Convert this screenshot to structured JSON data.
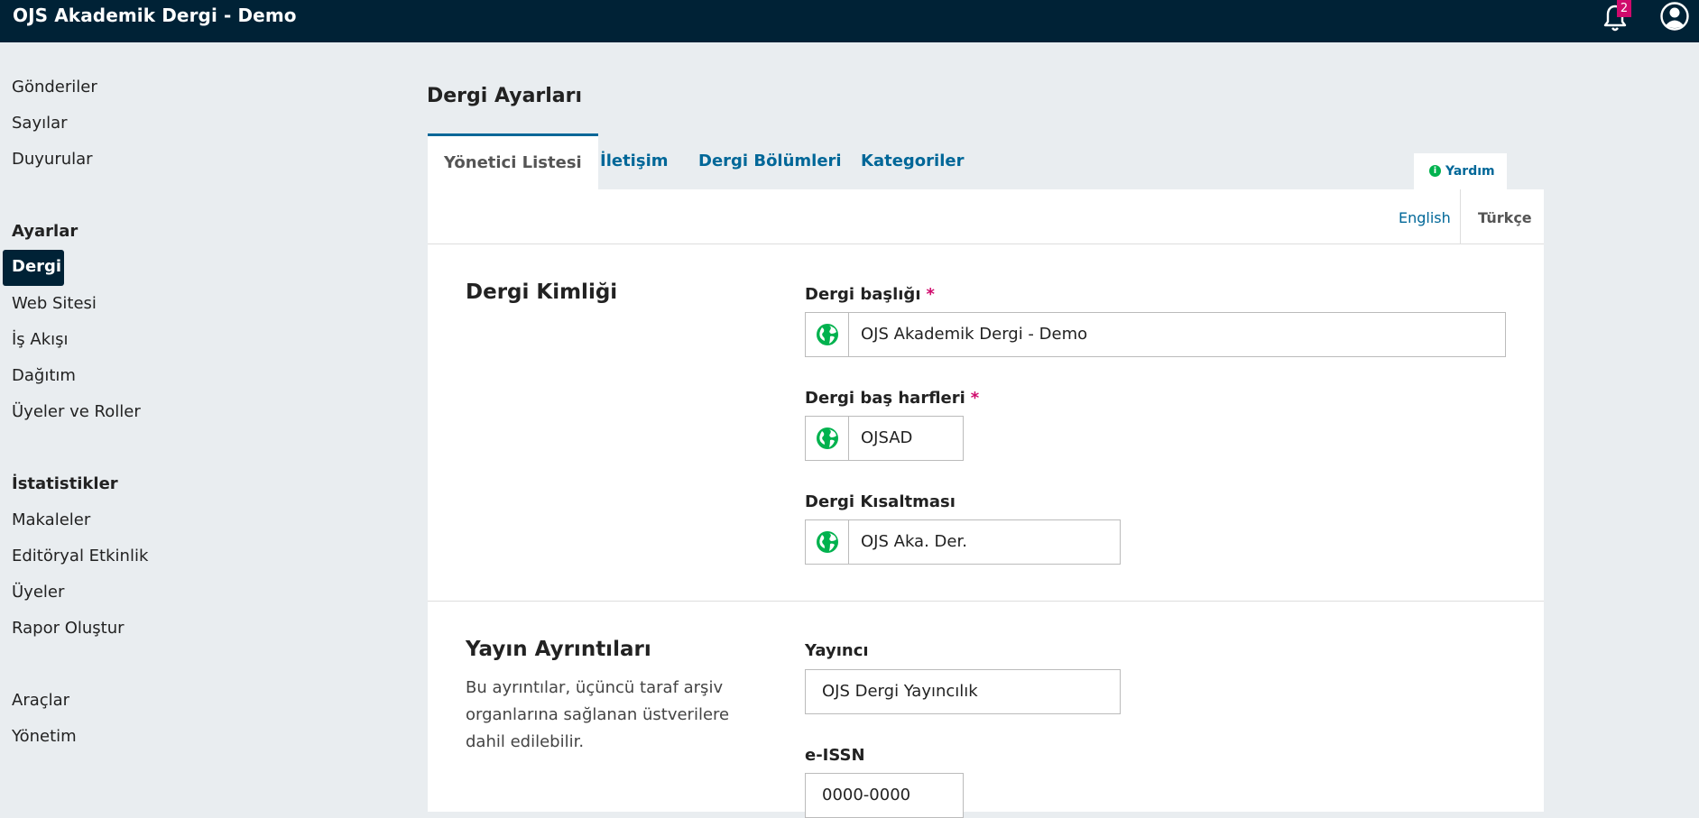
{
  "app": {
    "title": "OJS Akademik Dergi - Demo",
    "notification_count": "2"
  },
  "sidebar": {
    "items_top": [
      "Gönderiler",
      "Sayılar",
      "Duyurular"
    ],
    "settings_heading": "Ayarlar",
    "settings_active": "Dergi",
    "settings_items": [
      "Web Sitesi",
      "İş Akışı",
      "Dağıtım",
      "Üyeler ve Roller"
    ],
    "stats_heading": "İstatistikler",
    "stats_items": [
      "Makaleler",
      "Editöryal Etkinlik",
      "Üyeler",
      "Rapor Oluştur"
    ],
    "bottom_items": [
      "Araçlar",
      "Yönetim"
    ]
  },
  "main": {
    "page_title": "Dergi Ayarları",
    "tabs": [
      "Yönetici Listesi",
      "İletişim",
      "Dergi Bölümleri",
      "Kategoriler"
    ],
    "active_tab": "Yönetici Listesi",
    "help_label": "Yardım",
    "languages": [
      "English",
      "Türkçe"
    ],
    "active_language": "Türkçe"
  },
  "identity": {
    "title": "Dergi Kimliği",
    "journal_title_label": "Dergi başlığı",
    "journal_title_value": "OJS Akademik Dergi - Demo",
    "initials_label": "Dergi baş harfleri",
    "initials_value": "OJSAD",
    "abbreviation_label": "Dergi Kısaltması",
    "abbreviation_value": "OJS Aka. Der.",
    "required_mark": "*"
  },
  "publishing": {
    "title": "Yayın Ayrıntıları",
    "description": "Bu ayrıntılar, üçüncü taraf arşiv organlarına sağlanan üstverilere dahil edilebilir.",
    "publisher_label": "Yayıncı",
    "publisher_value": "OJS Dergi Yayıncılık",
    "eissn_label": "e-ISSN",
    "eissn_value": "0000-0000"
  },
  "colors": {
    "topbar": "#002236",
    "link": "#006798",
    "required": "#d00a6c",
    "globe": "#00b24e"
  },
  "icons": [
    "bell-icon",
    "user-icon",
    "info-icon",
    "globe-icon"
  ]
}
